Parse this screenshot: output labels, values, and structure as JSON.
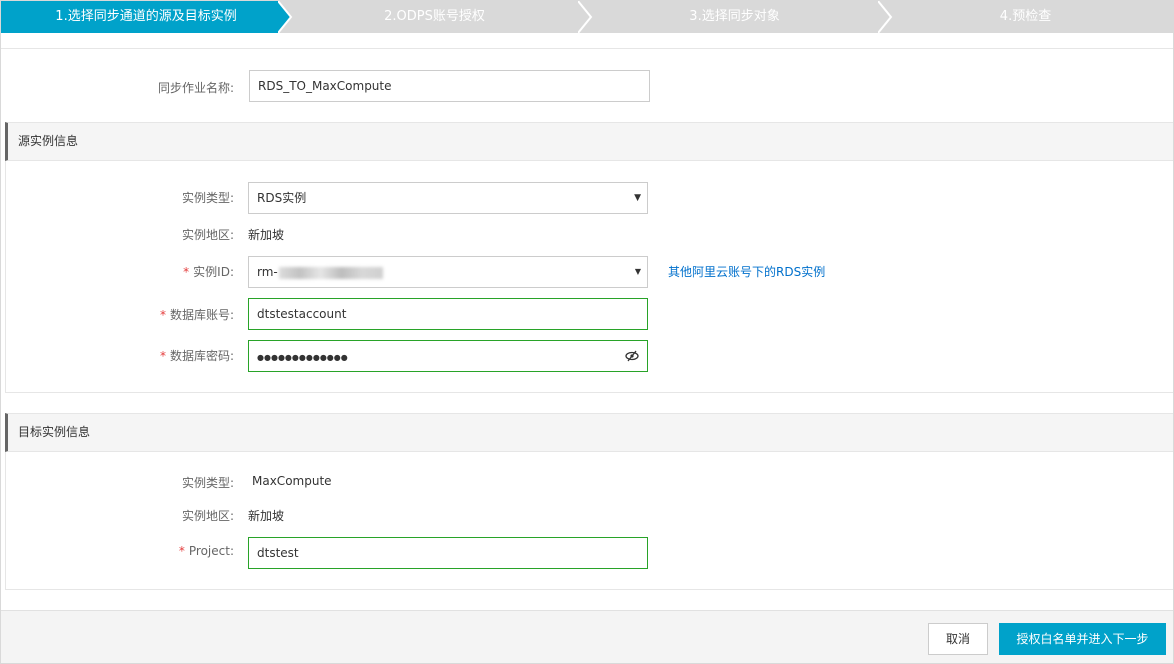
{
  "stepper": {
    "steps": [
      {
        "label": "1.选择同步通道的源及目标实例",
        "active": true
      },
      {
        "label": "2.ODPS账号授权",
        "active": false
      },
      {
        "label": "3.选择同步对象",
        "active": false
      },
      {
        "label": "4.预检查",
        "active": false
      }
    ],
    "colors": {
      "active": "#00a2ca",
      "inactive": "#d9d9d9"
    }
  },
  "job": {
    "name_label": "同步作业名称:",
    "name_value": "RDS_TO_MaxCompute"
  },
  "source": {
    "title": "源实例信息",
    "type_label": "实例类型:",
    "type_value": "RDS实例",
    "region_label": "实例地区:",
    "region_value": "新加坡",
    "required_mark": "*",
    "id_label": "实例ID:",
    "id_value_prefix": "rm-",
    "other_account_link": "其他阿里云账号下的RDS实例",
    "account_label": "数据库账号:",
    "account_value": "dtstestaccount",
    "password_label": "数据库密码:",
    "password_value": "●●●●●●●●●●●●●",
    "eye_icon": "eye-slash-icon"
  },
  "target": {
    "title": "目标实例信息",
    "type_label": "实例类型:",
    "type_value": "MaxCompute",
    "region_label": "实例地区:",
    "region_value": "新加坡",
    "required_mark": "*",
    "project_label": "Project:",
    "project_value": "dtstest"
  },
  "footer": {
    "cancel_label": "取消",
    "next_label": "授权白名单并进入下一步"
  }
}
